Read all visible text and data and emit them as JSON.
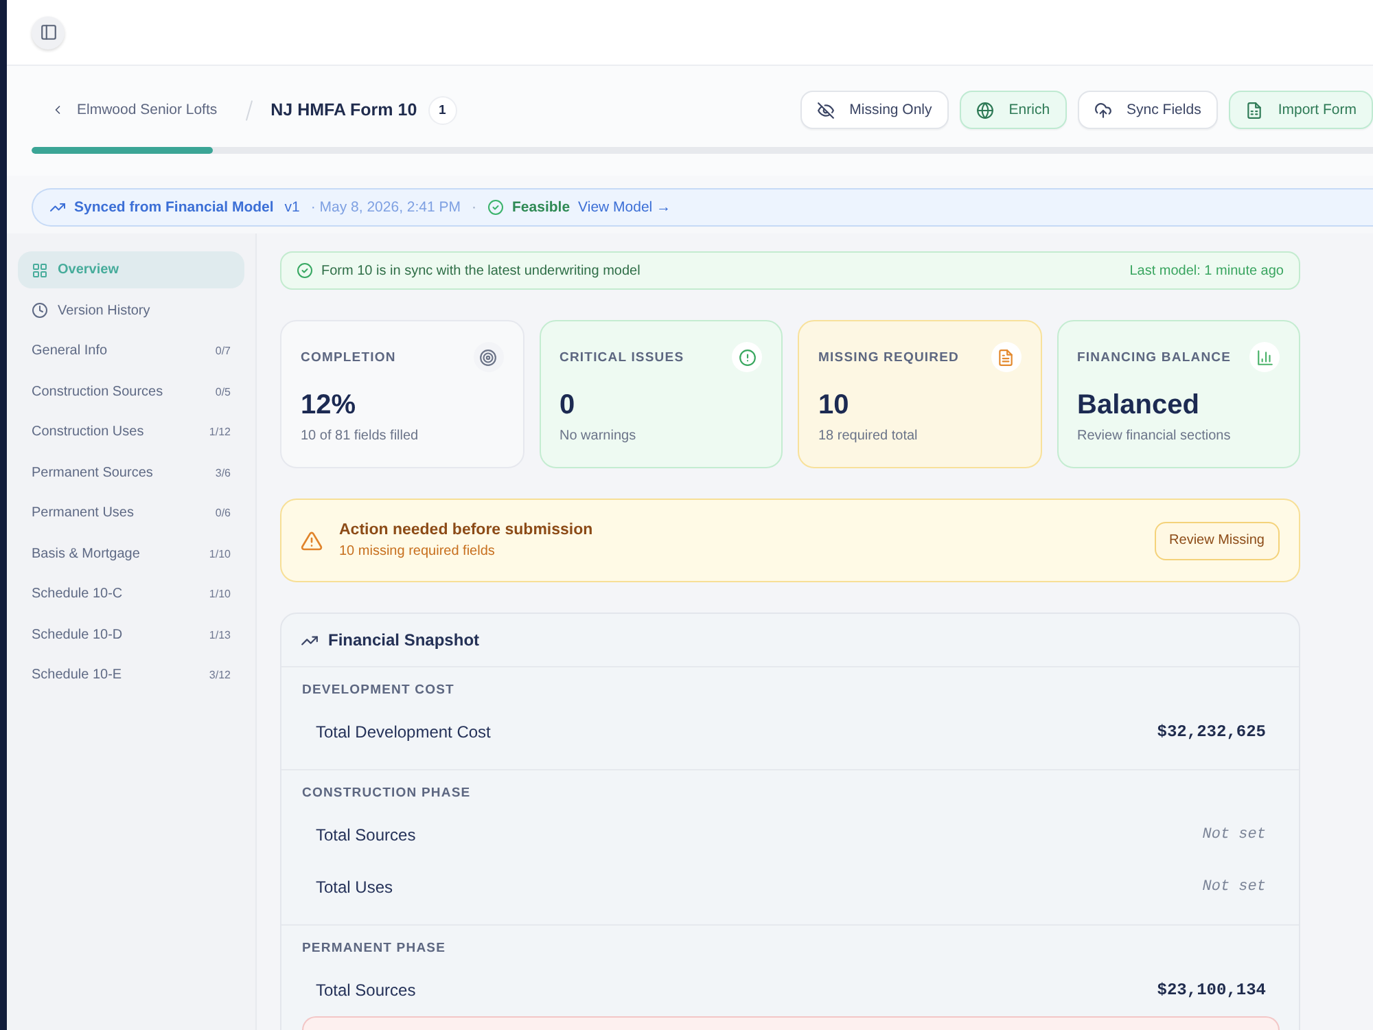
{
  "header": {
    "back_link": "Elmwood Senior Lofts",
    "title": "NJ HMFA Form 10",
    "badge": "1",
    "actions": [
      {
        "label": "Missing Only",
        "kind": "filter"
      },
      {
        "label": "Enrich",
        "kind": "enrich"
      },
      {
        "label": "Sync Fields",
        "kind": "sync"
      },
      {
        "label": "Import Form",
        "kind": "import"
      }
    ],
    "progress": {
      "level": 0.135
    }
  },
  "sync_banner": {
    "source": "Synced from Financial Model",
    "version": "v1",
    "timestamp": "· May 8, 2026, 2:41 PM",
    "separator": "·",
    "status": "Feasible",
    "link": "View Model →"
  },
  "sidebar": {
    "items": [
      {
        "label": "Overview",
        "kind": "overview",
        "selected": true
      },
      {
        "label": "Version History",
        "kind": "history",
        "selected": false
      },
      {
        "label": "General Info",
        "kind": "section",
        "count": "0/7",
        "selected": false
      },
      {
        "label": "Construction Sources",
        "kind": "section",
        "count": "0/5",
        "selected": false
      },
      {
        "label": "Construction Uses",
        "kind": "section",
        "count": "1/12",
        "selected": false
      },
      {
        "label": "Permanent Sources",
        "kind": "section",
        "count": "3/6",
        "selected": false
      },
      {
        "label": "Permanent Uses",
        "kind": "section",
        "count": "0/6",
        "selected": false
      },
      {
        "label": "Basis & Mortgage",
        "kind": "section",
        "count": "1/10",
        "selected": false
      },
      {
        "label": "Schedule 10-C",
        "kind": "section",
        "count": "1/10",
        "selected": false
      },
      {
        "label": "Schedule 10-D",
        "kind": "section",
        "count": "1/13",
        "selected": false
      },
      {
        "label": "Schedule 10-E",
        "kind": "section",
        "count": "3/12",
        "selected": false
      }
    ]
  },
  "sync_status": {
    "message": "Form 10 is in sync with the latest underwriting model",
    "meta": "Last model: 1 minute ago"
  },
  "stats": [
    {
      "label": "COMPLETION",
      "kind": "completion",
      "color": "#e6e8ee",
      "value": "12%",
      "detail": "10 of 81 fields filled"
    },
    {
      "label": "CRITICAL ISSUES",
      "kind": "issues",
      "color": "#c4ecd1",
      "value": "0",
      "detail": "No warnings"
    },
    {
      "label": "MISSING REQUIRED",
      "kind": "missing",
      "color": "#f8e19b",
      "value": "10",
      "detail": "18 required total"
    },
    {
      "label": "FINANCING BALANCE",
      "kind": "balance",
      "color": "#c4ecd1",
      "value": "Balanced",
      "detail": "Review financial sections"
    }
  ],
  "alert": {
    "title": "Action needed before submission",
    "detail": "10 missing required fields",
    "action": "Review Missing"
  },
  "snapshot": {
    "title": "Financial Snapshot",
    "sections": [
      {
        "heading": "DEVELOPMENT COST",
        "rows": [
          {
            "label": "Total Development Cost",
            "value": "$32,232,625",
            "set": true
          }
        ]
      },
      {
        "heading": "CONSTRUCTION PHASE",
        "rows": [
          {
            "label": "Total Sources",
            "value": "Not set",
            "set": false
          },
          {
            "label": "Total Uses",
            "value": "Not set",
            "set": false
          }
        ]
      },
      {
        "heading": "PERMANENT PHASE",
        "rows": [
          {
            "label": "Total Sources",
            "value": "$23,100,134",
            "set": true
          }
        ],
        "error": true
      }
    ]
  }
}
